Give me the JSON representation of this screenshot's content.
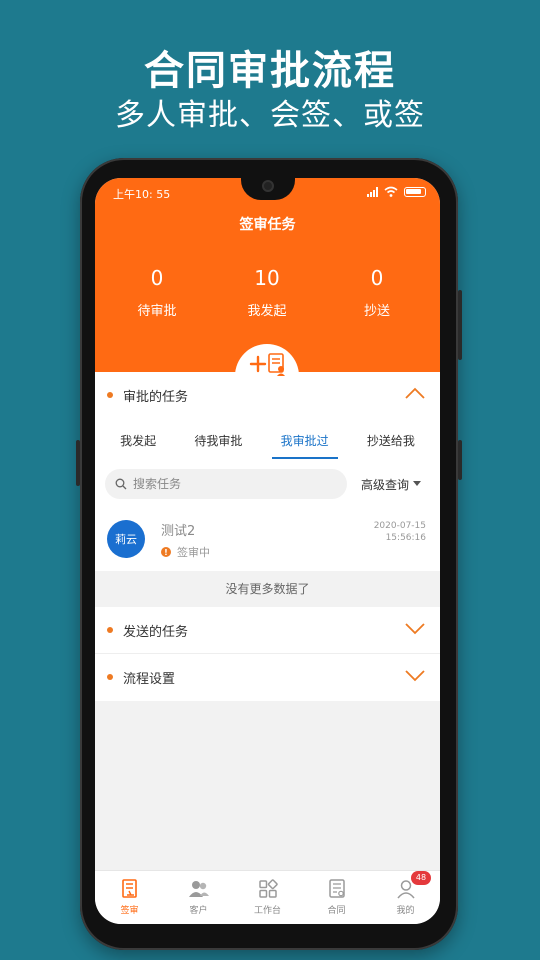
{
  "promo": {
    "title": "合同审批流程",
    "subtitle": "多人审批、会签、或签"
  },
  "status_bar": {
    "time": "上午10: 55"
  },
  "header": {
    "title": "签审任务",
    "stats": [
      {
        "value": "0",
        "label": "待审批"
      },
      {
        "value": "10",
        "label": "我发起"
      },
      {
        "value": "0",
        "label": "抄送"
      }
    ]
  },
  "approval_section": {
    "title": "审批的任务",
    "tabs": [
      {
        "label": "我发起"
      },
      {
        "label": "待我审批"
      },
      {
        "label": "我审批过"
      },
      {
        "label": "抄送给我"
      }
    ],
    "active_tab": "我审批过",
    "search_placeholder": "搜索任务",
    "advanced_query": "高级查询",
    "items": [
      {
        "avatar": "莉云",
        "name": "测试2",
        "status": "签审中",
        "date": "2020-07-15",
        "time": "15:56:16"
      }
    ],
    "no_more": "没有更多数据了"
  },
  "sent_section": {
    "title": "发送的任务"
  },
  "flow_section": {
    "title": "流程设置"
  },
  "bottom_nav": {
    "items": [
      {
        "label": "签审",
        "icon": "sign-review-icon"
      },
      {
        "label": "客户",
        "icon": "customers-icon"
      },
      {
        "label": "工作台",
        "icon": "workbench-icon"
      },
      {
        "label": "合同",
        "icon": "contract-icon"
      },
      {
        "label": "我的",
        "icon": "profile-icon"
      }
    ],
    "profile_badge": "48"
  },
  "colors": {
    "background": "#1e7a8e",
    "header": "#ff6a13",
    "accent_blue": "#1a73c8",
    "accent_orange": "#ee7a22"
  }
}
